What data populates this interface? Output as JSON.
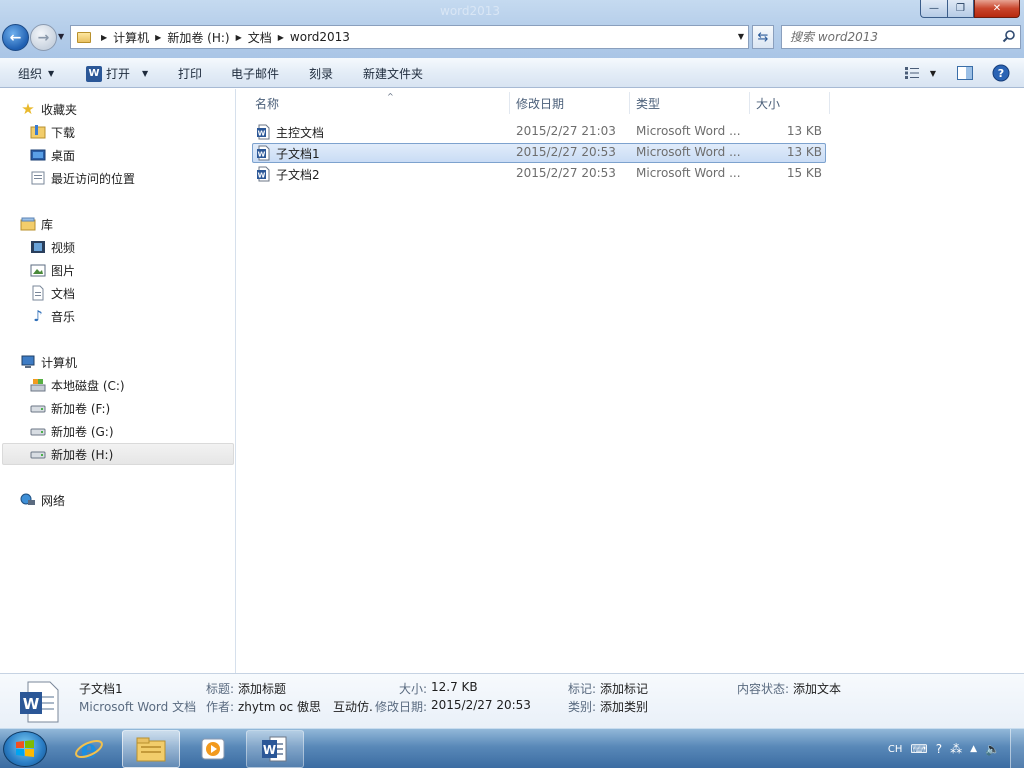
{
  "window": {
    "title": "word2013"
  },
  "address": {
    "crumbs": [
      "计算机",
      "新加卷 (H:)",
      "文档",
      "word2013"
    ]
  },
  "search": {
    "placeholder": "搜索 word2013"
  },
  "toolbar": {
    "organize": "组织",
    "open": "打开",
    "print": "打印",
    "email": "电子邮件",
    "burn": "刻录",
    "new_folder": "新建文件夹"
  },
  "sidebar": {
    "favorites": {
      "label": "收藏夹",
      "items": [
        "下载",
        "桌面",
        "最近访问的位置"
      ]
    },
    "libraries": {
      "label": "库",
      "items": [
        "视频",
        "图片",
        "文档",
        "音乐"
      ]
    },
    "computer": {
      "label": "计算机",
      "items": [
        "本地磁盘 (C:)",
        "新加卷 (F:)",
        "新加卷 (G:)",
        "新加卷 (H:)"
      ]
    },
    "network": {
      "label": "网络"
    }
  },
  "columns": {
    "name": "名称",
    "date": "修改日期",
    "type": "类型",
    "size": "大小"
  },
  "files": [
    {
      "name": "主控文档",
      "date": "2015/2/27 21:03",
      "type": "Microsoft Word ...",
      "size": "13 KB"
    },
    {
      "name": "子文档1",
      "date": "2015/2/27 20:53",
      "type": "Microsoft Word ...",
      "size": "13 KB"
    },
    {
      "name": "子文档2",
      "date": "2015/2/27 20:53",
      "type": "Microsoft Word ...",
      "size": "15 KB"
    }
  ],
  "details": {
    "filename": "子文档1",
    "filetype": "Microsoft Word 文档",
    "title_label": "标题:",
    "title_value": "添加标题",
    "author_label": "作者:",
    "author_value": "zhytm oc 傲思　互动仿...",
    "size_label": "大小:",
    "size_value": "12.7 KB",
    "modified_label": "修改日期:",
    "modified_value": "2015/2/27 20:53",
    "tags_label": "标记:",
    "tags_value": "添加标记",
    "category_label": "类别:",
    "category_value": "添加类别",
    "content_label": "内容状态:",
    "content_value": "添加文本"
  },
  "taskbar": {
    "lang": "CH"
  },
  "colors": {
    "selection": "#c9dcf5",
    "accent": "#2b5797",
    "taskbar": "#3f74aa"
  }
}
